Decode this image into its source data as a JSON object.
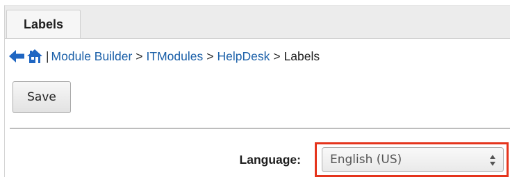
{
  "tab": {
    "label": "Labels"
  },
  "breadcrumb": {
    "separator": "|",
    "links": [
      "Module Builder",
      "ITModules",
      "HelpDesk"
    ],
    "current": "Labels",
    "arrow": ">"
  },
  "actions": {
    "save_label": "Save"
  },
  "language": {
    "label": "Language:",
    "selected": "English (US)",
    "highlight_color": "#e5341c"
  },
  "icons": {
    "back": "back-arrow-icon",
    "home": "home-icon",
    "select": "updown-arrows-icon"
  },
  "colors": {
    "link": "#1a5fa8",
    "icon": "#1f66c2"
  }
}
